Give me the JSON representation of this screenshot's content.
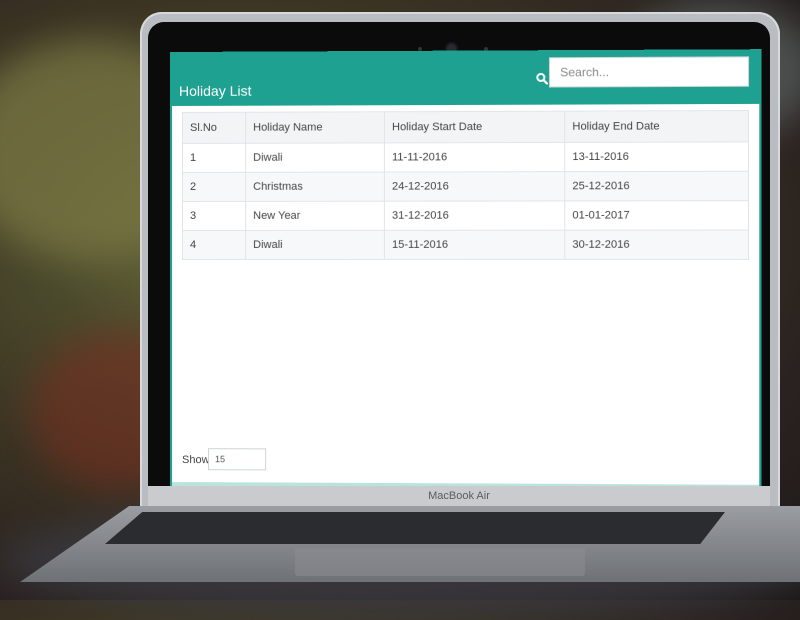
{
  "app": {
    "title": "Holiday List",
    "accent_color": "#1fa192"
  },
  "search": {
    "placeholder": "Search...",
    "icon": "search-icon"
  },
  "table": {
    "columns": [
      "Sl.No",
      "Holiday Name",
      "Holiday Start Date",
      "Holiday End Date"
    ],
    "rows": [
      [
        "1",
        "Diwali",
        "11-11-2016",
        "13-11-2016"
      ],
      [
        "2",
        "Christmas",
        "24-12-2016",
        "25-12-2016"
      ],
      [
        "3",
        "New Year",
        "31-12-2016",
        "01-01-2017"
      ],
      [
        "4",
        "Diwali",
        "15-11-2016",
        "30-12-2016"
      ]
    ]
  },
  "pagination": {
    "show_label": "Show",
    "page_size": "15"
  },
  "device": {
    "brand_label": "MacBook Air"
  }
}
